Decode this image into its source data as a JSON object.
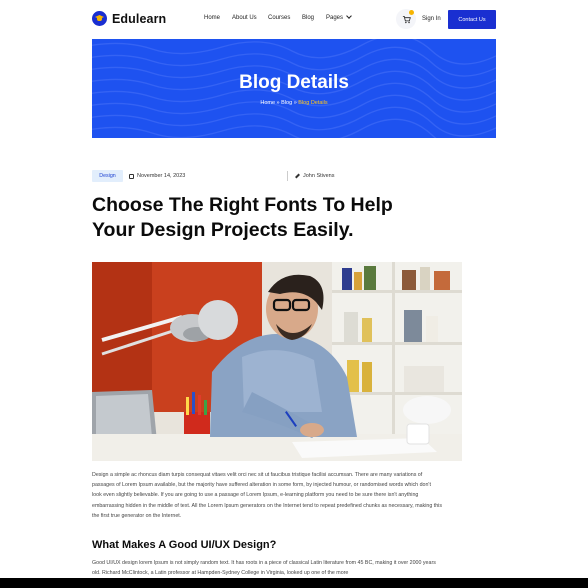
{
  "brand": {
    "name": "Edulearn"
  },
  "nav": {
    "items": [
      "Home",
      "About Us",
      "Courses",
      "Blog",
      "Pages"
    ]
  },
  "header": {
    "signin_label": "Sign In",
    "contact_label": "Contact Us"
  },
  "hero": {
    "title": "Blog Details",
    "breadcrumb": {
      "home": "Home",
      "sep": "»",
      "blog": "Blog",
      "current": "Blog Details"
    }
  },
  "post": {
    "tag": "Design",
    "date": "November 14, 2023",
    "author": "John Stivens",
    "title_line1": "Choose The Right Fonts To Help",
    "title_line2": "Your Design Projects Easily.",
    "paragraph1": "Design a simple ac rhoncus diam turpis consequat vitaes velit orci nec sit ut faucibus tristique facilisi accumsan. There are many variations of passages of Lorem Ipsum available, but the majority have suffered alteration in some form, by injected humour, or randomised words which don't look even slightly believable. If you are going to use a passage of Lorem Ipsum, e-learning platform you need to be sure there isn't anything embarrassing hidden in the middle of text. All the Lorem Ipsum generators on the Internet tend to repeat predefined chunks as necessary, making this the first true generator on the Internet.",
    "section_heading": "What Makes A Good UI/UX Design?",
    "paragraph2": "Good UI/UX design lorem Ipsum is not simply random text. It has roots in a piece of classical Latin literature from 45 BC, making it over 2000 years old. Richard McClintock, a Latin professor at Hampden-Sydney College in Virginia, looked up one of the more"
  },
  "colors": {
    "primary": "#1a2fd1",
    "hero_bg": "#1e52f0",
    "accent": "#f7b500",
    "tag_bg": "#e2eefc"
  },
  "icons": {
    "logo": "graduation-cap-icon",
    "cart": "cart-icon",
    "date": "calendar-icon",
    "author": "pen-icon",
    "chevron": "chevron-down-icon"
  }
}
